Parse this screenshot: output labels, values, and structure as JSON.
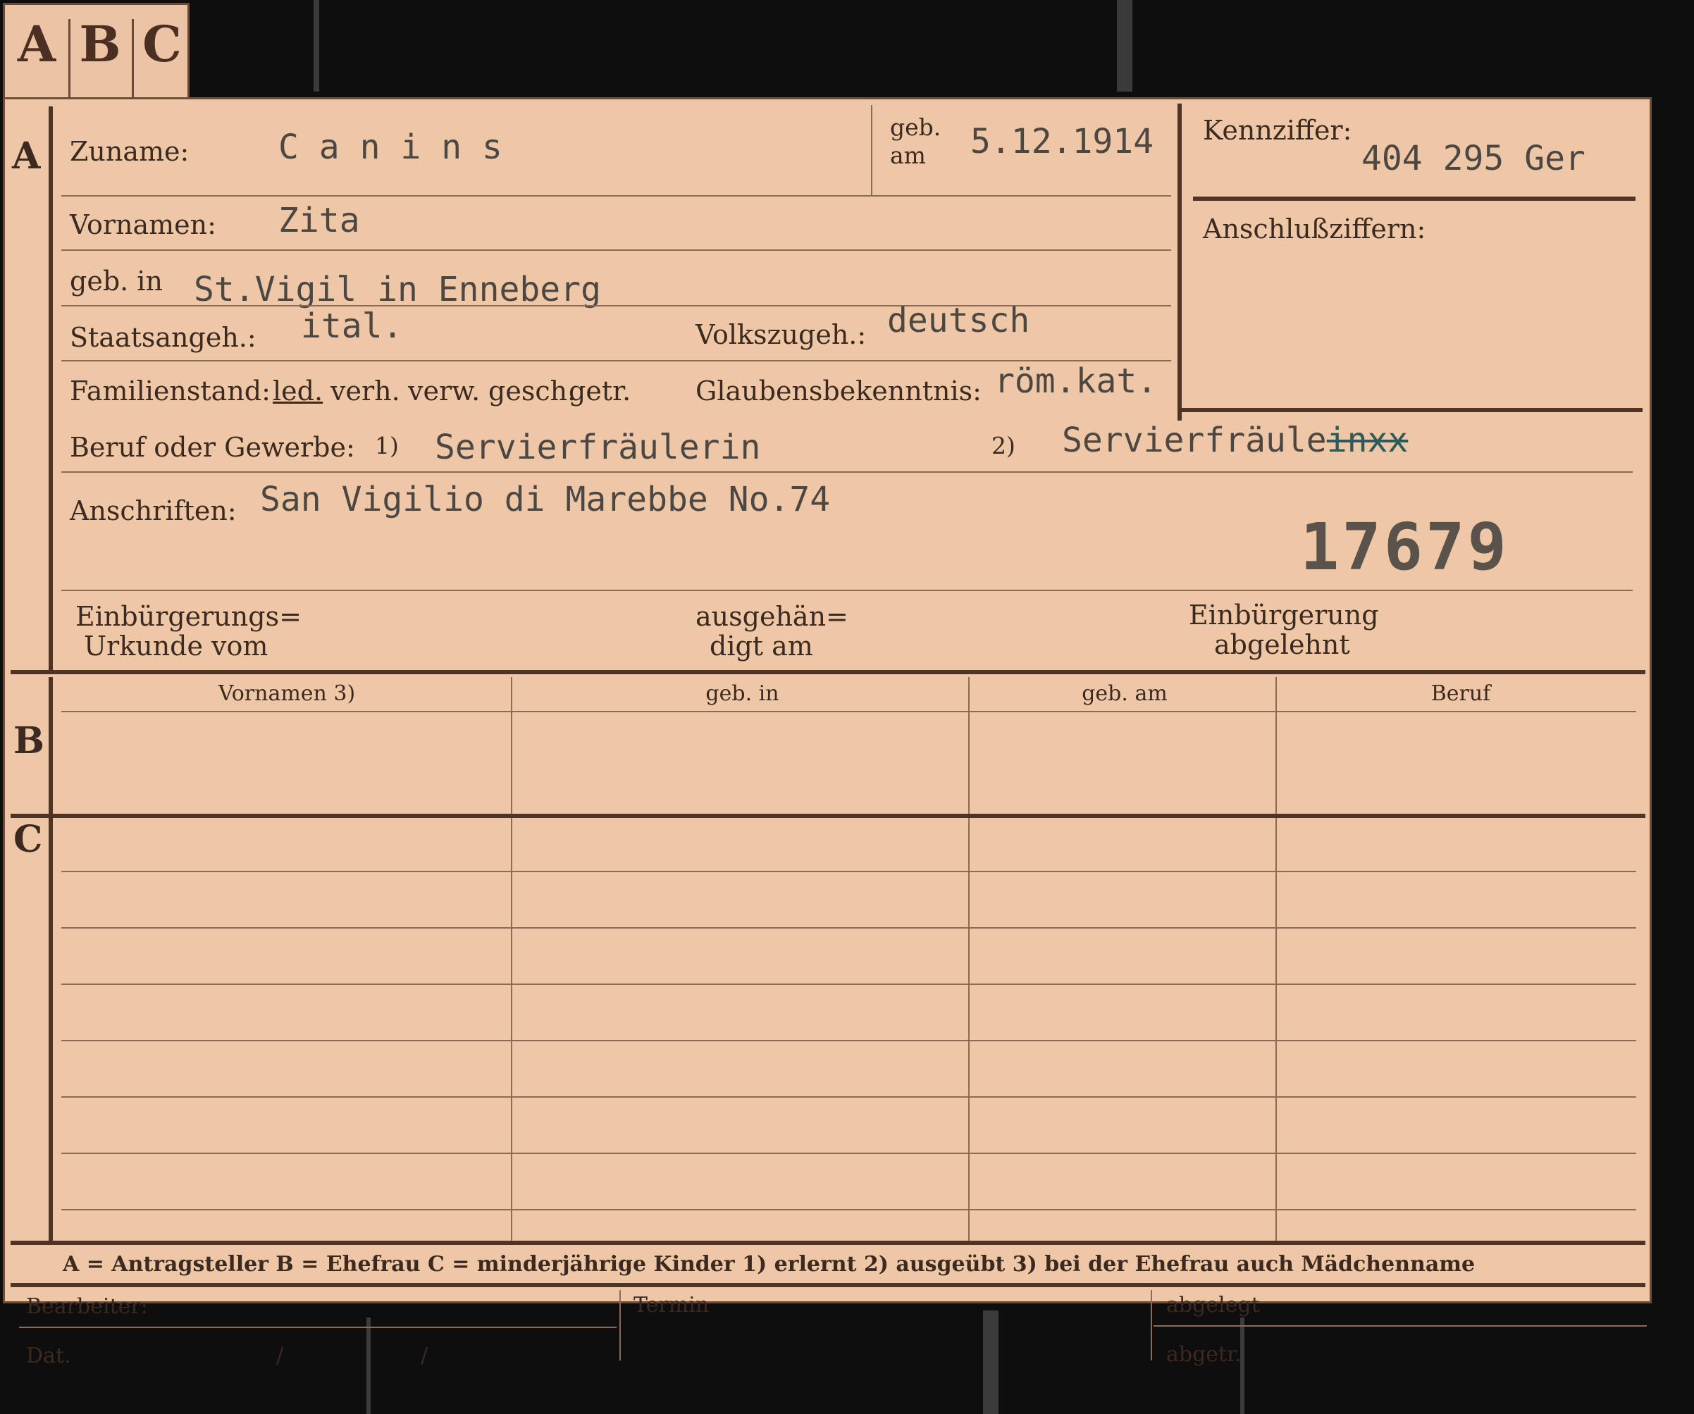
{
  "tab": {
    "letters": [
      "A",
      "B",
      "C"
    ]
  },
  "section_a": {
    "side_letter": "A",
    "surname_label": "Zuname:",
    "surname": "C a n i n s",
    "birth_date_label_1": "geb.",
    "birth_date_label_2": "am",
    "birth_date": "5.12.1914",
    "first_names_label": "Vornamen:",
    "first_names": "Zita",
    "birthplace_label": "geb. in",
    "birthplace": "St.Vigil in Enneberg",
    "citizenship_label": "Staatsangeh.:",
    "citizenship": "ital.",
    "ethnicity_label": "Volkszugeh.:",
    "ethnicity": "deutsch",
    "marital_status_label": "Familienstand:",
    "marital_options": [
      "led.",
      "verh.",
      "verw.",
      "gesch.",
      "getr."
    ],
    "religion_label": "Glaubensbekenntnis:",
    "religion": "röm.kat.",
    "occupation_label": "Beruf oder Gewerbe:",
    "occupation_marker_1": "1)",
    "occupation_1": "Servierfräulerin",
    "occupation_marker_2": "2)",
    "occupation_2_prefix": "Servierfräule",
    "occupation_2_struck": "inxx",
    "address_label": "Anschriften:",
    "address": "San Vigilio di Marebbe No.74",
    "file_number": "17679",
    "naturalization_label_1": "Einbürgerungs=",
    "naturalization_label_2": "Urkunde vom",
    "delivered_label_1": "ausgehän=",
    "delivered_label_2": "digt am",
    "rejected_label_1": "Einbürgerung",
    "rejected_label_2": "abgelehnt"
  },
  "id_box": {
    "code_label": "Kennziffer:",
    "code_value": "404 295   Ger",
    "linked_label": "Anschlußziffern:"
  },
  "section_b": {
    "side_letter": "B",
    "headers": [
      "Vornamen 3)",
      "geb. in",
      "geb. am",
      "Beruf"
    ]
  },
  "section_c": {
    "side_letter": "C"
  },
  "legend": {
    "text": "A = Antragsteller   B = Ehefrau   C = minderjährige Kinder   1) erlernt   2) ausgeübt   3) bei der Ehefrau auch Mädchenname"
  },
  "footer": {
    "clerk_label": "Bearbeiter:",
    "date_label": "Dat.",
    "date_sep_1": "/",
    "date_sep_2": "/",
    "deadline_label": "Termin",
    "filed_label": "abgelegt",
    "sent_label": "abgetr."
  },
  "colors": {
    "card": "#eec7a7",
    "rule": "#4f3426",
    "typewriter": "#4d4743",
    "struck": "#2f5a5a",
    "background": "#0e0e0e"
  }
}
